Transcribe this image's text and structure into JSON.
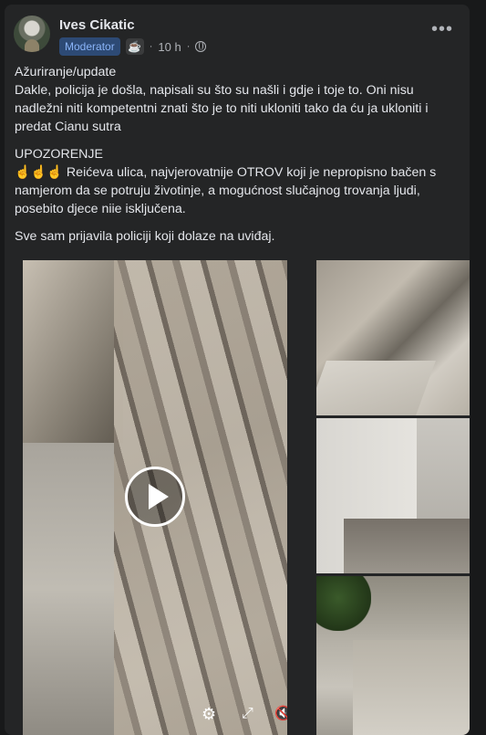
{
  "post": {
    "author": "Ives Cikatic",
    "role_badge": "Moderator",
    "time": "10 h",
    "dot": "·",
    "menu_label": "•••",
    "icons": {
      "avatar": "avatar",
      "badge_icon": "coffee-cup-icon",
      "privacy": "globe-icon",
      "more": "more-options-icon"
    },
    "paragraphs": [
      "Ažuriranje/update",
      "Dakle, policija je došla, napisali su što su našli i gdje i toje to. Oni nisu nadležni niti kompetentni znati što je to niti ukloniti tako da ću ja ukloniti i predat Cianu sutra",
      "UPOZORENJE",
      "☝☝☝ Reićeva ulica, najvjerovatnije OTROV koji je nepropisno bačen s namjerom da se potruju životinje, a mogućnost slučajnog  trovanja ljudi, posebito djece niie isključena.",
      "Sve sam prijavila policiji koji dolaze na uviđaj."
    ]
  },
  "video_controls": {
    "settings": "⚙",
    "expand": "⤢",
    "mute": "🔇"
  },
  "colors": {
    "background": "#18191a",
    "card": "#242526",
    "text": "#e4e6eb",
    "muted": "#b0b3b8",
    "badge_bg": "#2d4a75",
    "badge_text": "#8ab4f8"
  }
}
